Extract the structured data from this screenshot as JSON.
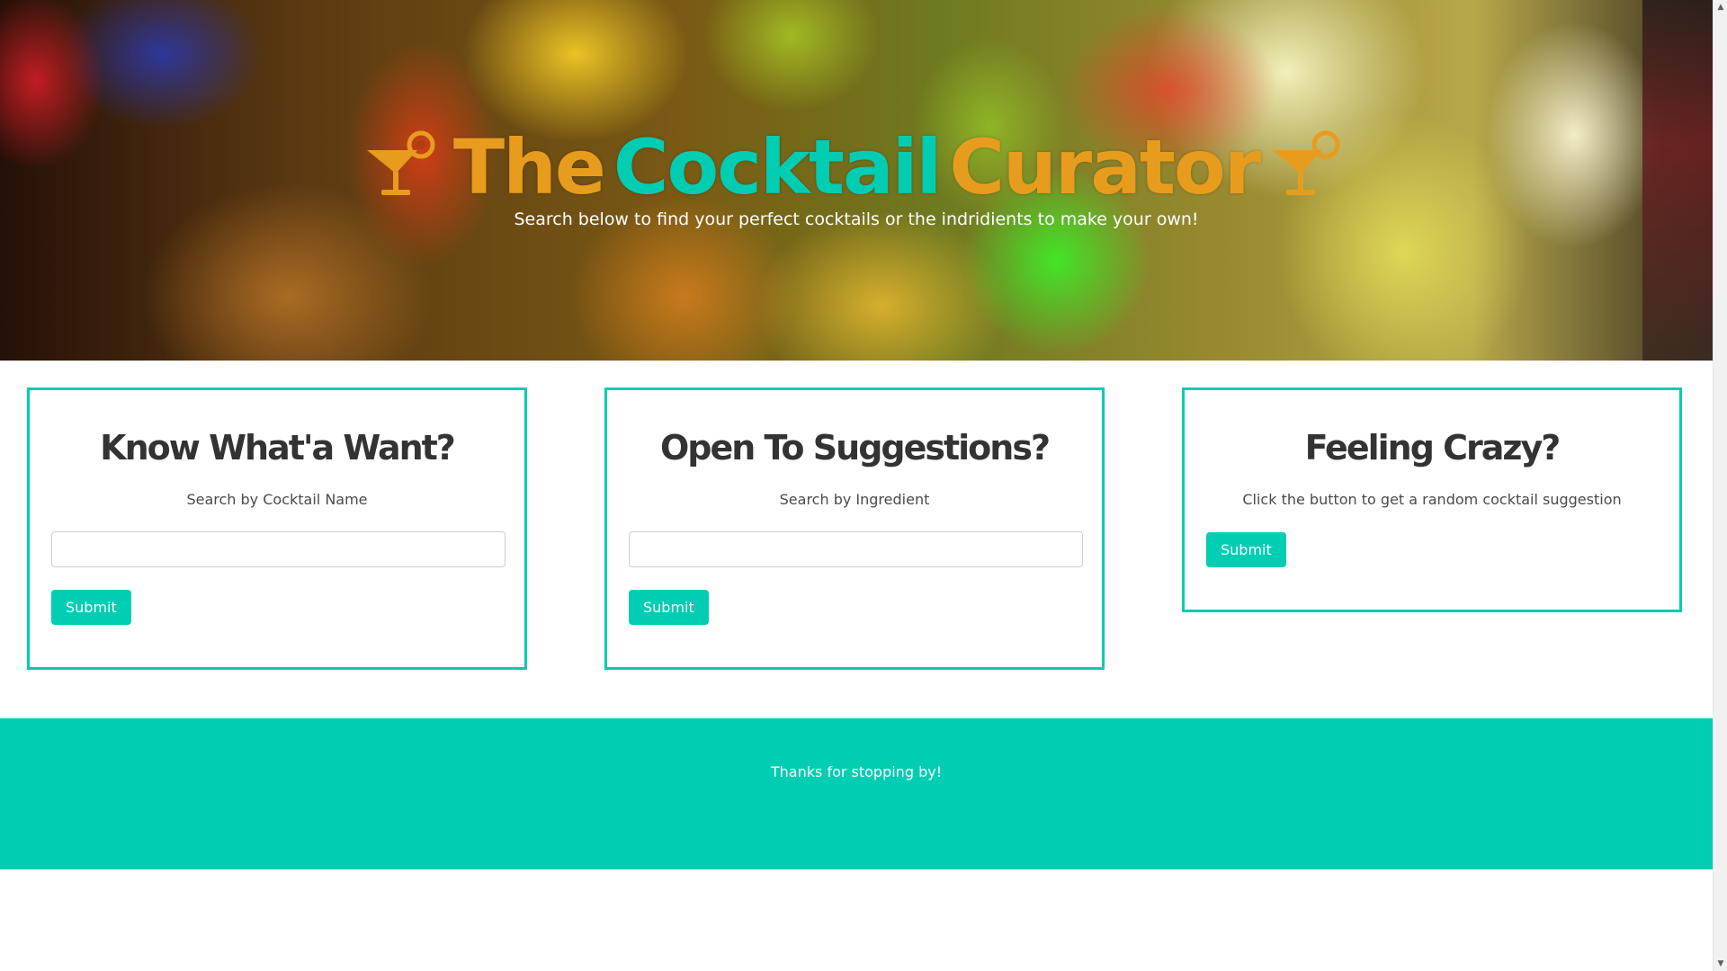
{
  "hero": {
    "title_words": [
      "The",
      "Cocktail",
      "Curator"
    ],
    "subtitle": "Search below to find your perfect cocktails or the indridients to make your own!",
    "icons": [
      "cocktail-glass-icon",
      "cocktail-glass-icon"
    ],
    "colors": {
      "title_orange": "#e89c1e",
      "title_teal": "#00cdb2"
    }
  },
  "cards": [
    {
      "heading": "Know What'a Want?",
      "description": "Search by Cocktail Name",
      "input_value": "",
      "button_label": "Submit"
    },
    {
      "heading": "Open To Suggestions?",
      "description": "Search by Ingredient",
      "input_value": "",
      "button_label": "Submit"
    },
    {
      "heading": "Feeling Crazy?",
      "description": "Click the button to get a random cocktail suggestion",
      "button_label": "Submit"
    }
  ],
  "footer": {
    "text": "Thanks for stopping by!"
  },
  "colors": {
    "accent": "#00cdb2",
    "heading": "#333333"
  },
  "scrollbar": {
    "up_icon": "scroll-up-arrow-icon",
    "down_icon": "scroll-down-arrow-icon"
  }
}
